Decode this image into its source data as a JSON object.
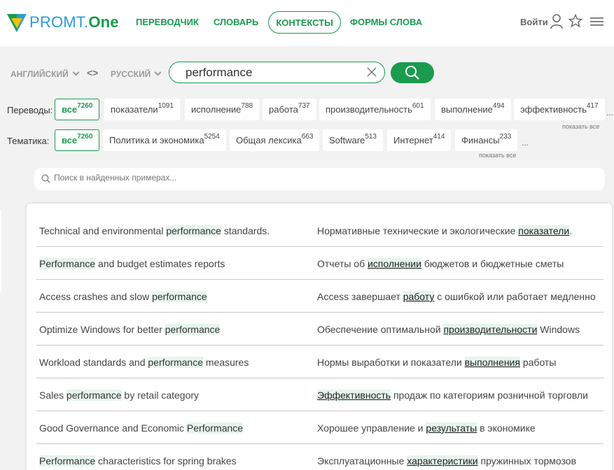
{
  "header": {
    "logo_main": "PROMT.",
    "logo_accent": "One",
    "nav": [
      "ПЕРЕВОДЧИК",
      "СЛОВАРЬ",
      "КОНТЕКСТЫ",
      "ФОРМЫ СЛОВА"
    ],
    "active_nav": "КОНТЕКСТЫ",
    "login": "Войти",
    "icons": [
      "user-icon",
      "star-icon",
      "menu-icon"
    ]
  },
  "search": {
    "source_lang": "АНГЛИЙСКИЙ",
    "swap_symbol": "<>",
    "target_lang": "РУССКИЙ",
    "query": "performance"
  },
  "translations": {
    "label": "Переводы:",
    "chips": [
      {
        "text": "все",
        "count": "7260"
      },
      {
        "text": "показатели",
        "count": "1091"
      },
      {
        "text": "исполнение",
        "count": "788"
      },
      {
        "text": "работа",
        "count": "737"
      },
      {
        "text": "производительность",
        "count": "601"
      },
      {
        "text": "выполнение",
        "count": "494"
      },
      {
        "text": "эффективность",
        "count": "417"
      }
    ],
    "more": "...",
    "show_all": "показать все"
  },
  "topics": {
    "label": "Тематика:",
    "chips": [
      {
        "text": "все",
        "count": "7260"
      },
      {
        "text": "Политика и экономика",
        "count": "5254"
      },
      {
        "text": "Общая лексика",
        "count": "663"
      },
      {
        "text": "Software",
        "count": "513"
      },
      {
        "text": "Интернет",
        "count": "414"
      },
      {
        "text": "Финансы",
        "count": "233"
      }
    ],
    "more": "...",
    "show_all": "показать все"
  },
  "filter": {
    "placeholder": "Поиск в найденных примерах..."
  },
  "examples": [
    {
      "src_before": "Technical and environmental ",
      "src_hl": "performance",
      "src_after": " standards.",
      "tgt_before": "Нормативные технические и экологические ",
      "tgt_hl": "показатели",
      "tgt_after": "."
    },
    {
      "src_before": "",
      "src_hl": "Performance",
      "src_after": " and budget estimates reports",
      "tgt_before": "Отчеты об ",
      "tgt_hl": "исполнении",
      "tgt_after": " бюджетов и бюджетные сметы"
    },
    {
      "src_before": "Access crashes and slow ",
      "src_hl": "performance",
      "src_after": "",
      "tgt_before": "Access завершает ",
      "tgt_hl": "работу",
      "tgt_after": " с ошибкой или работает медленно"
    },
    {
      "src_before": "Optimize Windows for better ",
      "src_hl": "performance",
      "src_after": "",
      "tgt_before": "Обеспечение оптимальной ",
      "tgt_hl": "производительности",
      "tgt_after": " Windows"
    },
    {
      "src_before": "Workload standards and ",
      "src_hl": "performance",
      "src_after": " measures",
      "tgt_before": "Нормы выработки и показатели ",
      "tgt_hl": "выполнения",
      "tgt_after": " работы"
    },
    {
      "src_before": "Sales ",
      "src_hl": "performance",
      "src_after": " by retail category",
      "tgt_before": "",
      "tgt_hl": "Эффективность",
      "tgt_after": " продаж по категориям розничной торговли"
    },
    {
      "src_before": "Good Governance and Economic ",
      "src_hl": "Performance",
      "src_after": "",
      "tgt_before": "Хорошее управление и ",
      "tgt_hl": "результаты",
      "tgt_after": " в экономике"
    },
    {
      "src_before": "",
      "src_hl": "Performance",
      "src_after": " characteristics for spring brakes",
      "tgt_before": "Эксплуатационные ",
      "tgt_hl": "характеристики",
      "tgt_after": " пружинных тормозов"
    }
  ]
}
